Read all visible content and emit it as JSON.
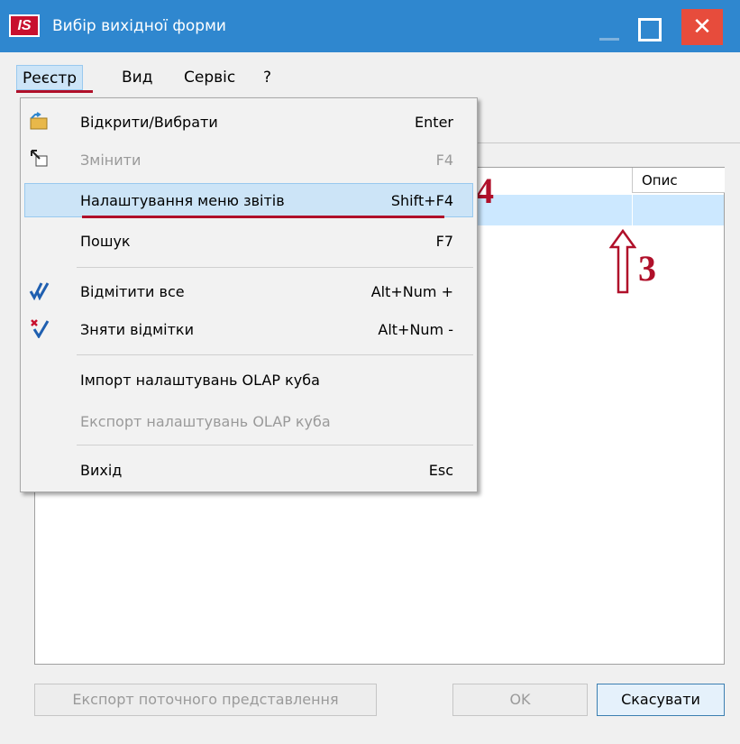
{
  "window": {
    "logo": "IS",
    "title": "Вибір вихідної форми",
    "close_glyph": "✕"
  },
  "menubar": {
    "items": [
      {
        "label": "Реєстр"
      },
      {
        "label": "Вид"
      },
      {
        "label": "Сервіс"
      },
      {
        "label": "?"
      }
    ]
  },
  "grid": {
    "columns": [
      {
        "label": "Опис"
      }
    ]
  },
  "annotations": {
    "step3": "3",
    "step4": "4"
  },
  "dropdown": {
    "items": [
      {
        "label": "Відкрити/Вибрати",
        "shortcut": "Enter",
        "icon": "folder-open-icon"
      },
      {
        "label": "Змінити",
        "shortcut": "F4",
        "icon": "edit-pointer-icon"
      },
      {
        "label": "Налаштування меню звітів",
        "shortcut": "Shift+F4"
      },
      {
        "label": "Пошук",
        "shortcut": "F7"
      },
      {
        "label": "Відмітити все",
        "shortcut": "Alt+Num +",
        "icon": "check-all-icon"
      },
      {
        "label": "Зняти відмітки",
        "shortcut": "Alt+Num -",
        "icon": "uncheck-all-icon"
      },
      {
        "label": "Імпорт налаштувань OLAP куба"
      },
      {
        "label": "Експорт налаштувань OLAP куба"
      },
      {
        "label": "Вихід",
        "shortcut": "Esc"
      }
    ]
  },
  "footer": {
    "export_label": "Експорт поточного представлення",
    "ok_label": "OK",
    "cancel_label": "Скасувати"
  },
  "colors": {
    "titlebar": "#2f87cf",
    "accent_red": "#b0102a",
    "close_button": "#e74c3c",
    "selection": "#cce4f7"
  }
}
